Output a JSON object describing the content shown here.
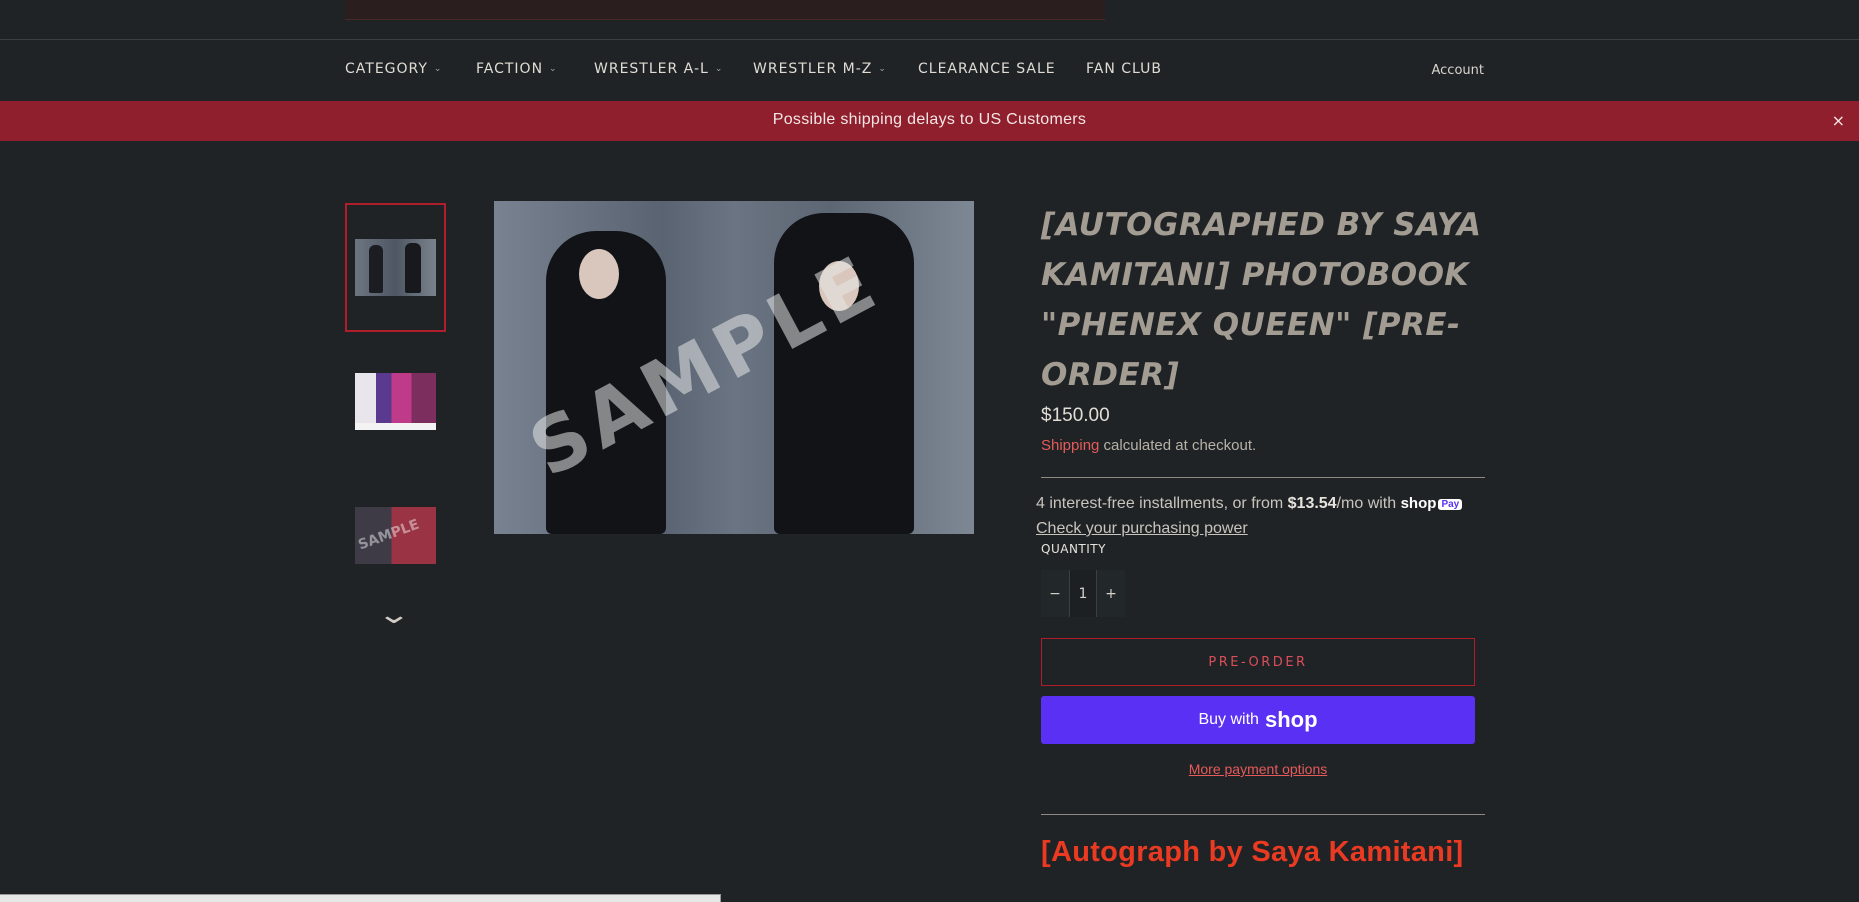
{
  "nav": {
    "items": [
      {
        "label": "CATEGORY",
        "dropdown": true
      },
      {
        "label": "FACTION",
        "dropdown": true
      },
      {
        "label": "WRESTLER A-L",
        "dropdown": true
      },
      {
        "label": "WRESTLER M-Z",
        "dropdown": true
      },
      {
        "label": "CLEARANCE SALE",
        "dropdown": false
      },
      {
        "label": "FAN CLUB",
        "dropdown": false
      }
    ],
    "account": "Account"
  },
  "banner": {
    "message": "Possible shipping delays to US Customers",
    "close": "×"
  },
  "gallery": {
    "thumbnails": [
      {
        "name": "thumb-photobook-spread",
        "active": true
      },
      {
        "name": "thumb-photobook-cover",
        "active": false
      },
      {
        "name": "thumb-photobook-sample",
        "active": false
      }
    ],
    "down_arrow": "⌄",
    "main_watermark": "SAMPLE"
  },
  "product": {
    "title": "[AUTOGRAPHED BY SAYA KAMITANI] PHOTOBOOK \"PHENEX QUEEN\" [PRE-ORDER]",
    "price": "$150.00",
    "shipping_link": "Shipping",
    "shipping_text": " calculated at checkout.",
    "installments_prefix": "4 interest-free installments, or from ",
    "installments_amount": "$13.54",
    "installments_suffix": "/mo with ",
    "shoppay_label": "shop",
    "shoppay_badge": "Pay",
    "check_power": "Check your purchasing power",
    "quantity_label": "QUANTITY",
    "quantity_minus": "−",
    "quantity_value": "1",
    "quantity_plus": "+",
    "preorder_button": "PRE-ORDER",
    "buy_with": "Buy with",
    "buy_logo": "shop",
    "more_payment": "More payment options",
    "description_heading": "[Autograph by Saya Kamitani]"
  },
  "colors": {
    "background": "#1f2326",
    "banner": "#8f1f2c",
    "accent": "#b01e2c",
    "shop_pay": "#5a31f4",
    "heading_red": "#ea3a22"
  }
}
